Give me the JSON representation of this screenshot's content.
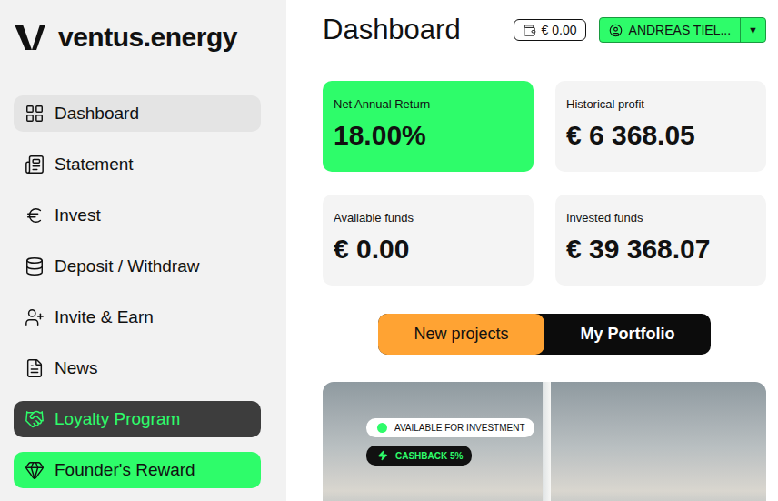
{
  "logo": {
    "text": "ventus.energy"
  },
  "sidebar": {
    "items": [
      {
        "label": "Dashboard",
        "selected": true,
        "kind": "normal"
      },
      {
        "label": "Statement",
        "selected": false,
        "kind": "normal"
      },
      {
        "label": "Invest",
        "selected": false,
        "kind": "normal"
      },
      {
        "label": "Deposit / Withdraw",
        "selected": false,
        "kind": "normal"
      },
      {
        "label": "Invite & Earn",
        "selected": false,
        "kind": "normal"
      },
      {
        "label": "News",
        "selected": false,
        "kind": "normal"
      },
      {
        "label": "Loyalty Program",
        "selected": false,
        "kind": "dark"
      },
      {
        "label": "Founder's Reward",
        "selected": false,
        "kind": "highlight"
      }
    ]
  },
  "header": {
    "title": "Dashboard",
    "wallet": "€ 0.00",
    "user": "ANDREAS TIEL...",
    "dropdown": "▼"
  },
  "stats": [
    {
      "label": "Net Annual Return",
      "value": "18.00%",
      "highlighted": true
    },
    {
      "label": "Historical profit",
      "value": "€ 6 368.05",
      "highlighted": false
    },
    {
      "label": "Available funds",
      "value": "€ 0.00",
      "highlighted": false
    },
    {
      "label": "Invested funds",
      "value": "€ 39 368.07",
      "highlighted": false
    }
  ],
  "tabs": [
    {
      "label": "New projects",
      "selected": true
    },
    {
      "label": "My Portfolio",
      "selected": false
    }
  ],
  "project": {
    "badges": [
      {
        "label": "AVAILABLE FOR INVESTMENT",
        "kind": "status"
      },
      {
        "label": "CASHBACK 5%",
        "kind": "cashback"
      }
    ]
  }
}
